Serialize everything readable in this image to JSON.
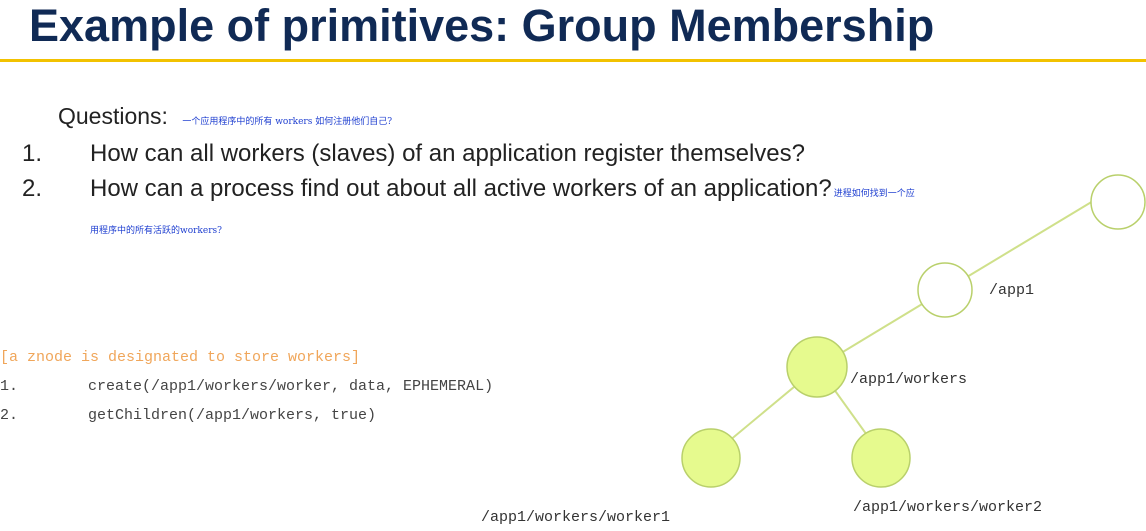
{
  "slide": {
    "title": "Example of primitives: Group Membership",
    "questions_label": "Questions:",
    "questions_note": "一个应用程序中的所有 workers 如何注册他们自己?",
    "questions": [
      {
        "num": "1.",
        "text": "How can all workers (slaves) of an application register themselves?",
        "note": ""
      },
      {
        "num": "2.",
        "text": "How can a process find out about all active workers of an application?",
        "note": "进程如何找到一个应用程序中的所有活跃的workers?"
      }
    ],
    "code": {
      "comment": "[a znode is designated to store workers]",
      "lines": [
        {
          "num": "1.",
          "text": "create(/app1/workers/worker, data, EPHEMERAL)"
        },
        {
          "num": "2.",
          "text": "getChildren(/app1/workers, true)"
        }
      ]
    }
  },
  "tree": {
    "nodes": [
      {
        "id": "root",
        "label": "/",
        "style": "outline"
      },
      {
        "id": "app1",
        "label": "/app1",
        "style": "outline"
      },
      {
        "id": "workers",
        "label": "/app1/workers",
        "style": "filled"
      },
      {
        "id": "worker1",
        "label": "/app1/workers/worker1",
        "style": "filled"
      },
      {
        "id": "worker2",
        "label": "/app1/workers/worker2",
        "style": "filled"
      }
    ],
    "edges": [
      [
        "root",
        "app1"
      ],
      [
        "app1",
        "workers"
      ],
      [
        "workers",
        "worker1"
      ],
      [
        "workers",
        "worker2"
      ]
    ],
    "colors": {
      "filled": "#e6fa8e",
      "outline_fill": "#ffffff",
      "stroke": "#b9d06b",
      "edge": "#cfe08a"
    }
  },
  "theme": {
    "title_color": "#102a55",
    "rule_color": "#f2c200",
    "note_color": "#1f3fd0",
    "comment_color": "#f0a65a"
  }
}
